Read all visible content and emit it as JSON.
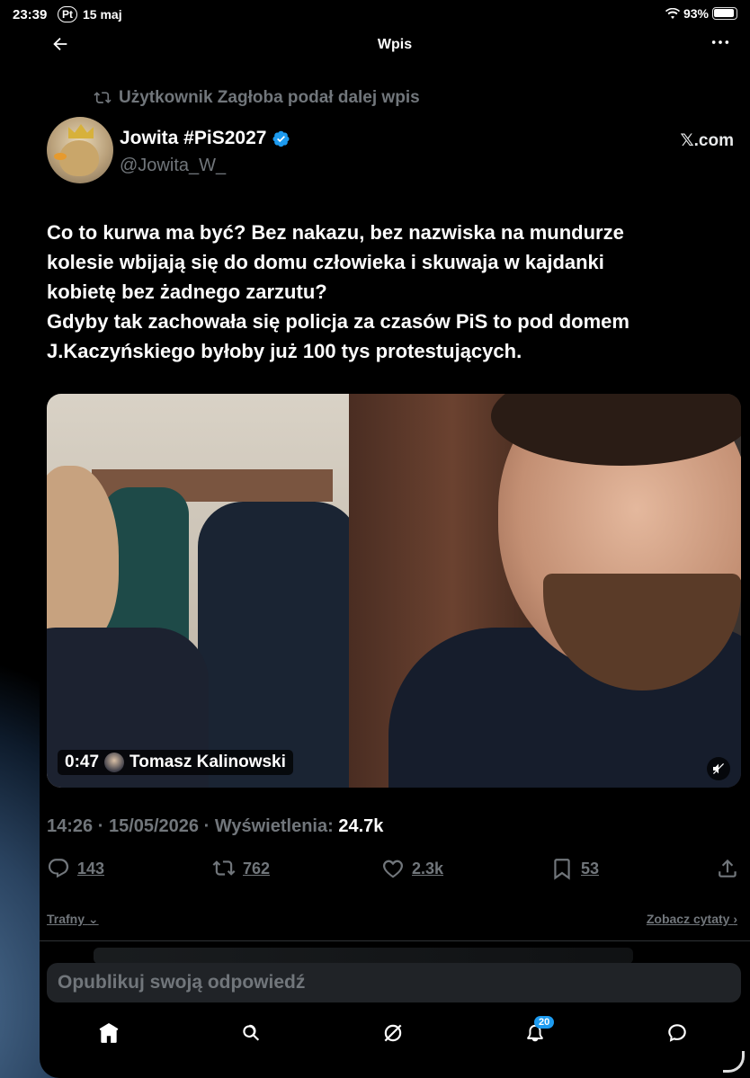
{
  "status_bar": {
    "time": "23:39",
    "day": "Pt",
    "date": "15 maj",
    "battery": "93%"
  },
  "header": {
    "title": "Wpis"
  },
  "retweet": {
    "text": "Użytkownik Zagłoba podał dalej wpis"
  },
  "author": {
    "name": "Jowita #PiS2027",
    "handle": "@Jowita_W_",
    "source": "𝕏.com"
  },
  "tweet": {
    "text": "Co to kurwa ma być? Bez nakazu, bez nazwiska na mundurze\nkolesie wbijają się do domu człowieka i skuwaja w kajdanki\nkobietę bez żadnego zarzutu?\nGdyby tak zachowała się policja za czasów PiS to pod domem\nJ.Kaczyńskiego byłoby już 100 tys protestujących."
  },
  "media": {
    "duration": "0:47",
    "credit": "Tomasz Kalinowski"
  },
  "meta": {
    "time": "14:26",
    "date": "15/05/2026",
    "views_label": "Wyświetlenia:",
    "views": "24.7k"
  },
  "actions": {
    "replies": "143",
    "reposts": "762",
    "likes": "2.3k",
    "bookmarks": "53"
  },
  "filters": {
    "sort": "Trafny",
    "quotes": "Zobacz cytaty"
  },
  "reply": {
    "placeholder": "Opublikuj swoją odpowiedź"
  },
  "tabbar": {
    "notifications": "20"
  },
  "colors": {
    "accent": "#1d9bf0",
    "muted": "#71767b",
    "background": "#000000"
  }
}
